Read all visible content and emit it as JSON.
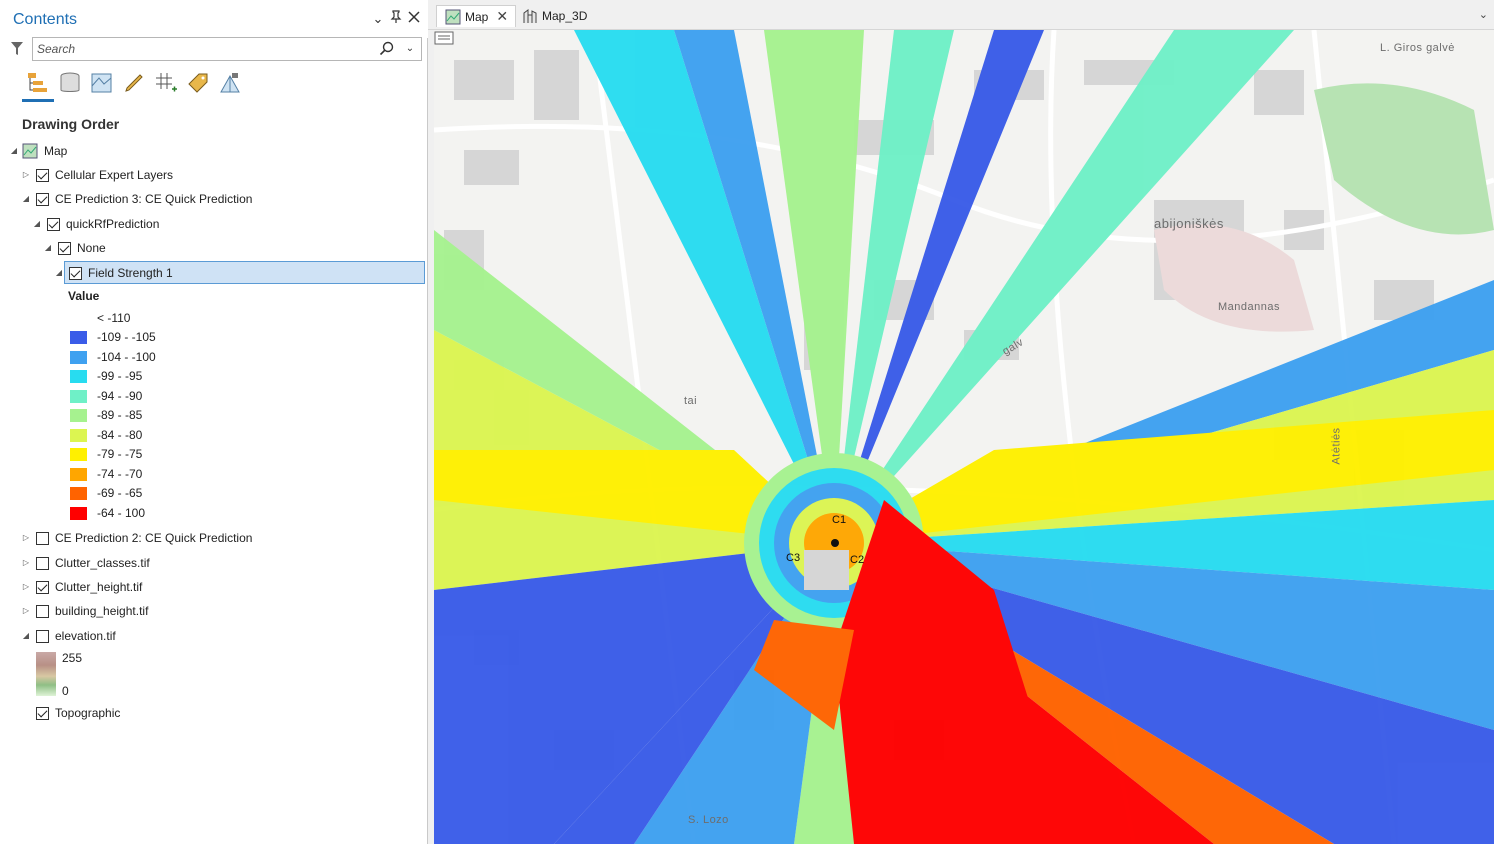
{
  "pane": {
    "title": "Contents",
    "search_placeholder": "Search",
    "section_title": "Drawing Order",
    "layers": [
      {
        "label": "Map",
        "checked": null
      },
      {
        "label": "Cellular Expert Layers",
        "checked": true
      },
      {
        "label": "CE Prediction 3: CE Quick Prediction",
        "checked": true
      },
      {
        "label": "quickRfPrediction",
        "checked": true
      },
      {
        "label": "None",
        "checked": true
      },
      {
        "label": "Field Strength 1",
        "checked": true
      },
      {
        "label": "CE Prediction 2: CE Quick Prediction",
        "checked": false
      },
      {
        "label": "Clutter_classes.tif",
        "checked": false
      },
      {
        "label": "Clutter_height.tif",
        "checked": true
      },
      {
        "label": "building_height.tif",
        "checked": false
      },
      {
        "label": "elevation.tif",
        "checked": false
      },
      {
        "label": "Topographic",
        "checked": true
      }
    ],
    "legend": {
      "heading": "Value",
      "classes": [
        {
          "label": "< -110",
          "color": "#ffffff"
        },
        {
          "label": "-109 - -105",
          "color": "#3a5ce8"
        },
        {
          "label": "-104 - -100",
          "color": "#3fa1f0"
        },
        {
          "label": "-99 - -95",
          "color": "#28dcf0"
        },
        {
          "label": "-94 - -90",
          "color": "#6ff0c7"
        },
        {
          "label": "-89 - -85",
          "color": "#a6f28f"
        },
        {
          "label": "-84 - -80",
          "color": "#dcf551"
        },
        {
          "label": "-79 - -75",
          "color": "#fff000"
        },
        {
          "label": "-74 - -70",
          "color": "#ffa600"
        },
        {
          "label": "-69 - -65",
          "color": "#ff6300"
        },
        {
          "label": "-64 - 100",
          "color": "#ff0000"
        }
      ]
    },
    "elevation": {
      "high": "255",
      "low": "0"
    }
  },
  "tabs": [
    {
      "label": "Map"
    },
    {
      "label": "Map_3D"
    }
  ],
  "map": {
    "labels": {
      "street1": "L. Giros galvė",
      "area1": "abijoniškės",
      "place1": "Mandannas",
      "street2": "Atėtiės",
      "street3": "S. Lozo",
      "frag1": "tai",
      "frag2": "galv"
    },
    "sites": [
      "C1",
      "C2",
      "C3"
    ]
  }
}
